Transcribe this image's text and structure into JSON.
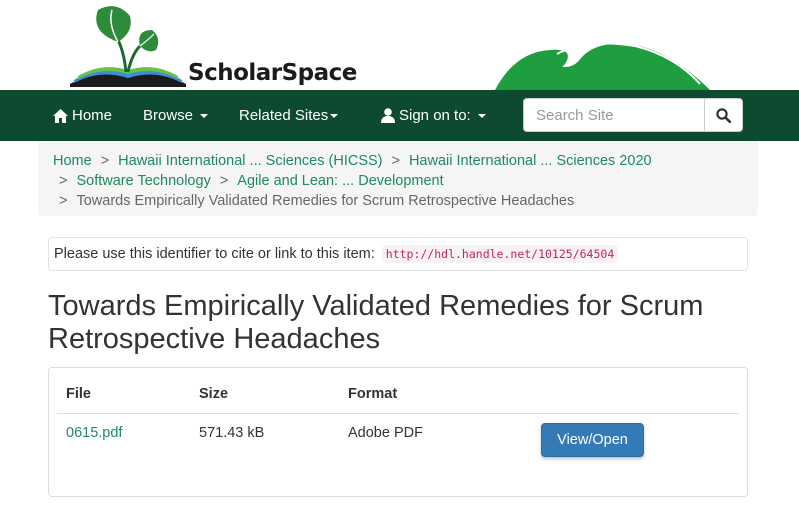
{
  "header": {
    "logo_text": "ScholarSpace"
  },
  "nav": {
    "home": "Home",
    "browse": "Browse",
    "related_sites": "Related Sites",
    "sign_on": "Sign on to:",
    "search_placeholder": "Search Site"
  },
  "breadcrumb": {
    "items": [
      "Home",
      "Hawaii International ... Sciences (HICSS)",
      "Hawaii International ... Sciences 2020",
      "Software Technology",
      "Agile and Lean: ... Development"
    ],
    "current": "Towards Empirically Validated Remedies for Scrum Retrospective Headaches",
    "separator": ">"
  },
  "identifier": {
    "label": "Please use this identifier to cite or link to this item:",
    "url": "http://hdl.handle.net/10125/64504"
  },
  "item": {
    "title": "Towards Empirically Validated Remedies for Scrum Retrospective Headaches"
  },
  "files": {
    "headers": [
      "File",
      "Size",
      "Format"
    ],
    "rows": [
      {
        "file": "0615.pdf",
        "size": "571.43 kB",
        "format": "Adobe PDF",
        "action": "View/Open"
      }
    ]
  },
  "colors": {
    "navbar": "#0d4a2f",
    "link": "#1f8a5b",
    "button": "#337ab7"
  }
}
